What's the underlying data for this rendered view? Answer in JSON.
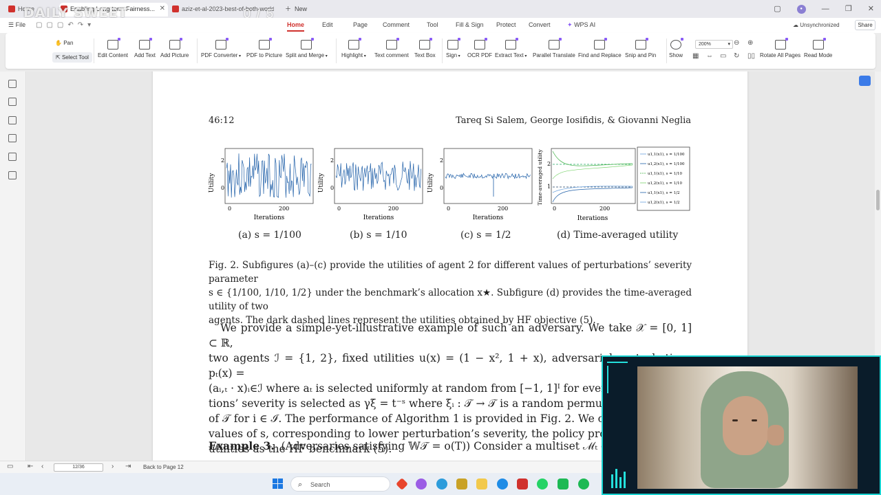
{
  "tabs": [
    {
      "label": "Home",
      "color": "#d0312d"
    },
    {
      "label": "Enabling Long-term Fairness...",
      "color": "#d0312d",
      "active": true
    },
    {
      "label": "aziz-et-al-2023-best-of-both-worlds...",
      "color": "#d0312d"
    }
  ],
  "new_tab_label": "New",
  "overlay": {
    "logo_text": "DAILY SWEET",
    "counter": "0 / 5"
  },
  "menu": {
    "file": "File",
    "items": [
      "Home",
      "Edit",
      "Page",
      "Comment",
      "Tool",
      "Fill & Sign",
      "Protect",
      "Convert",
      "WPS AI"
    ],
    "active": "Home",
    "unsync": "Unsynchronized",
    "share": "Share"
  },
  "ribbon": {
    "pan": "Pan",
    "select": "Select Tool",
    "tools": [
      "Edit Content",
      "Add Text",
      "Add Picture",
      "PDF Converter",
      "PDF to Picture",
      "Split and Merge",
      "Highlight",
      "Text comment",
      "Text Box",
      "Sign",
      "OCR PDF",
      "Extract Text",
      "Parallel Translate",
      "Find and Replace",
      "Snip and Pin",
      "Show",
      "Rotate All Pages",
      "Read Mode"
    ],
    "zoom": "200%"
  },
  "document": {
    "page_number": "46:12",
    "authors": "Tareq Si Salem, George Iosifidis, & Giovanni Neglia",
    "subfig_captions": [
      "(a) s = 1/100",
      "(b) s = 1/10",
      "(c) s = 1/2",
      "(d) Time-averaged utility"
    ],
    "axis_ylabel": "Utility",
    "axis_ylabel_d": "Time-averaged utility",
    "axis_xlabel": "Iterations",
    "legend_entries": [
      "u1,1(x1), s = 1/100",
      "u1,2(x1), s = 1/100",
      "u1,1(x1), s = 1/10",
      "u1,2(x1), s = 1/10",
      "u1,1(x1), s = 1/2",
      "u1,2(x1), s = 1/2"
    ],
    "figure_caption_1": "Fig. 2.  Subfigures (a)–(c) provide the utilities of agent 2 for different values of perturbations’ severity parameter",
    "figure_caption_2": "s ∈ {1/100, 1/10, 1/2} under the benchmark’s allocation x★. Subfigure (d) provides the time-averaged utility of two",
    "figure_caption_3": "agents. The dark dashed lines represent the utilities obtained by HF objective (5).",
    "para_lines": [
      "We provide a simple-yet-illustrative example of such an adversary. We take 𝒳 = [0, 1] ⊂ ℝ,",
      "two agents ℐ = {1, 2}, fixed utilities u(x) = (1 − x², 1 + x), adversarial perturbations pₜ(x) =",
      "(aᵢ,ₜ · x)ᵢ∈ℐ where aₜ is selected uniformly at random from [−1, 1]ᴵ for every t ∈",
      "tions’ severity is selected as γξ = t⁻ˢ where ξᵢ : 𝒯 → 𝒯 is a random permutati",
      "of 𝒯 for i ∈ ℐ. The performance of Algorithm 1 is provided in Fig. 2. We obse",
      "values of s, corresponding to lower perturbation’s severity, the policy provide",
      "utilities as the HF benchmark (5)."
    ],
    "example_label": "Example 3.",
    "example_text": "(Adversaries satisfying 𝕎𝒯 = o(T)) Consider a multiset ℳₜ c"
  },
  "status": {
    "page_indicator": "12/36",
    "back_link": "Back to Page 12"
  },
  "taskbar": {
    "search_placeholder": "Search"
  },
  "colors": {
    "accent": "#d0312d",
    "plot_blue": "#1f5fa8",
    "plot_green": "#3cb043",
    "webcam_frame": "#18d3d1"
  }
}
